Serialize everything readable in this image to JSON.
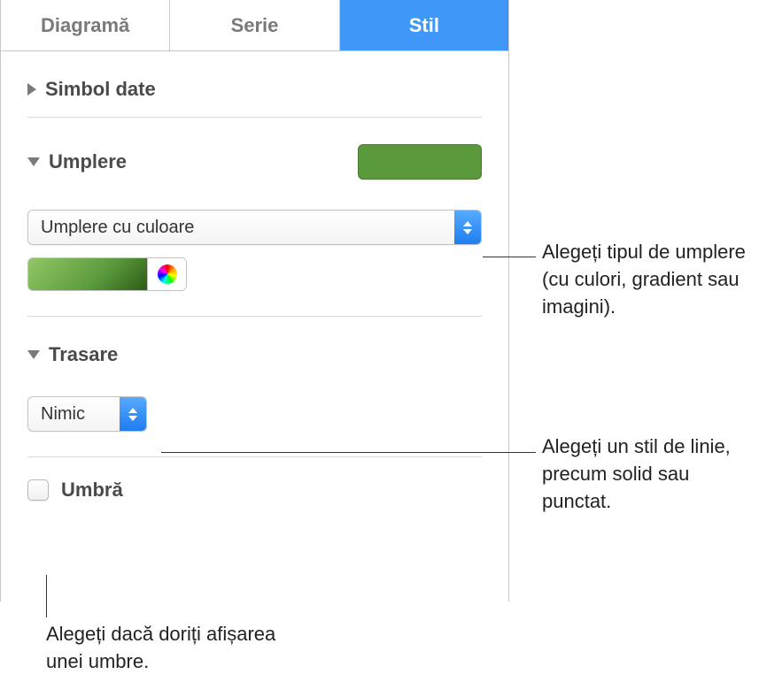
{
  "tabs": {
    "diagram": "Diagramă",
    "serie": "Serie",
    "stil": "Stil"
  },
  "sections": {
    "simbol_date": {
      "title": "Simbol date"
    },
    "umplere": {
      "title": "Umplere",
      "fill_type_label": "Umplere cu culoare",
      "swatch_color": "#5a9a3c"
    },
    "trasare": {
      "title": "Trasare",
      "stroke_label": "Nimic"
    },
    "umbra": {
      "title": "Umbră"
    }
  },
  "annotations": {
    "fill": "Alegeți tipul de umplere (cu culori, gradient sau imagini).",
    "stroke": "Alegeți un stil de linie, precum solid sau punctat.",
    "shadow": "Alegeți dacă doriți afișarea unei umbre."
  }
}
